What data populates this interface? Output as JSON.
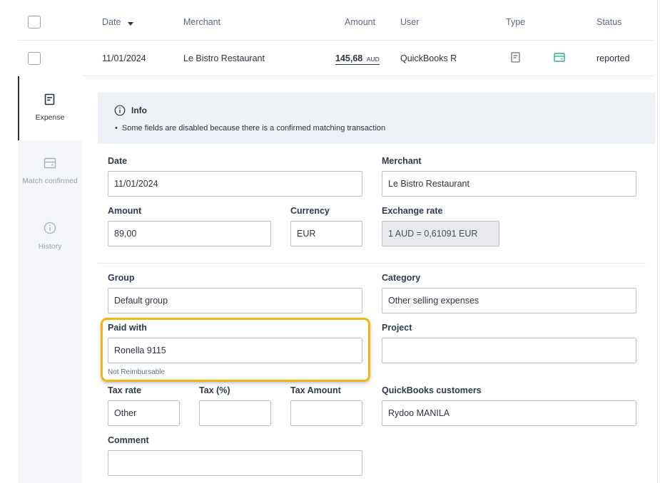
{
  "table": {
    "headers": {
      "date": "Date",
      "merchant": "Merchant",
      "amount": "Amount",
      "user": "User",
      "type": "Type",
      "status": "Status"
    },
    "row": {
      "date": "11/01/2024",
      "merchant": "Le Bistro Restaurant",
      "amount": "145,68",
      "currency": "AUD",
      "user": "QuickBooks R",
      "status": "reported"
    }
  },
  "sidebar": {
    "items": [
      {
        "label": "Expense",
        "icon": "receipt-icon",
        "active": true
      },
      {
        "label": "Match confirmed",
        "icon": "card-icon",
        "active": false
      },
      {
        "label": "History",
        "icon": "info-icon",
        "active": false
      }
    ]
  },
  "info": {
    "title": "Info",
    "message": "Some fields are disabled because there is a confirmed matching transaction"
  },
  "form": {
    "date": {
      "label": "Date",
      "value": "11/01/2024"
    },
    "merchant": {
      "label": "Merchant",
      "value": "Le Bistro Restaurant"
    },
    "amount": {
      "label": "Amount",
      "value": "89,00"
    },
    "currency": {
      "label": "Currency",
      "value": "EUR"
    },
    "exchange_rate": {
      "label": "Exchange rate",
      "value": "1 AUD = 0,61091 EUR"
    },
    "group": {
      "label": "Group",
      "value": "Default group"
    },
    "category": {
      "label": "Category",
      "value": "Other selling expenses"
    },
    "paid_with": {
      "label": "Paid with",
      "value": "Ronella 9115",
      "note": "Not Reimbursable"
    },
    "project": {
      "label": "Project",
      "value": ""
    },
    "tax_rate": {
      "label": "Tax rate",
      "value": "Other"
    },
    "tax_percent": {
      "label": "Tax (%)",
      "value": ""
    },
    "tax_amount": {
      "label": "Tax Amount",
      "value": ""
    },
    "qb_customers": {
      "label": "QuickBooks customers",
      "value": "Rydoo MANILA"
    },
    "comment": {
      "label": "Comment",
      "value": ""
    }
  },
  "colors": {
    "highlight": "#f2b40f",
    "match_icon": "#2bb673",
    "sidebar_bg": "#f4f6f9",
    "info_bg": "#eef2f7"
  }
}
